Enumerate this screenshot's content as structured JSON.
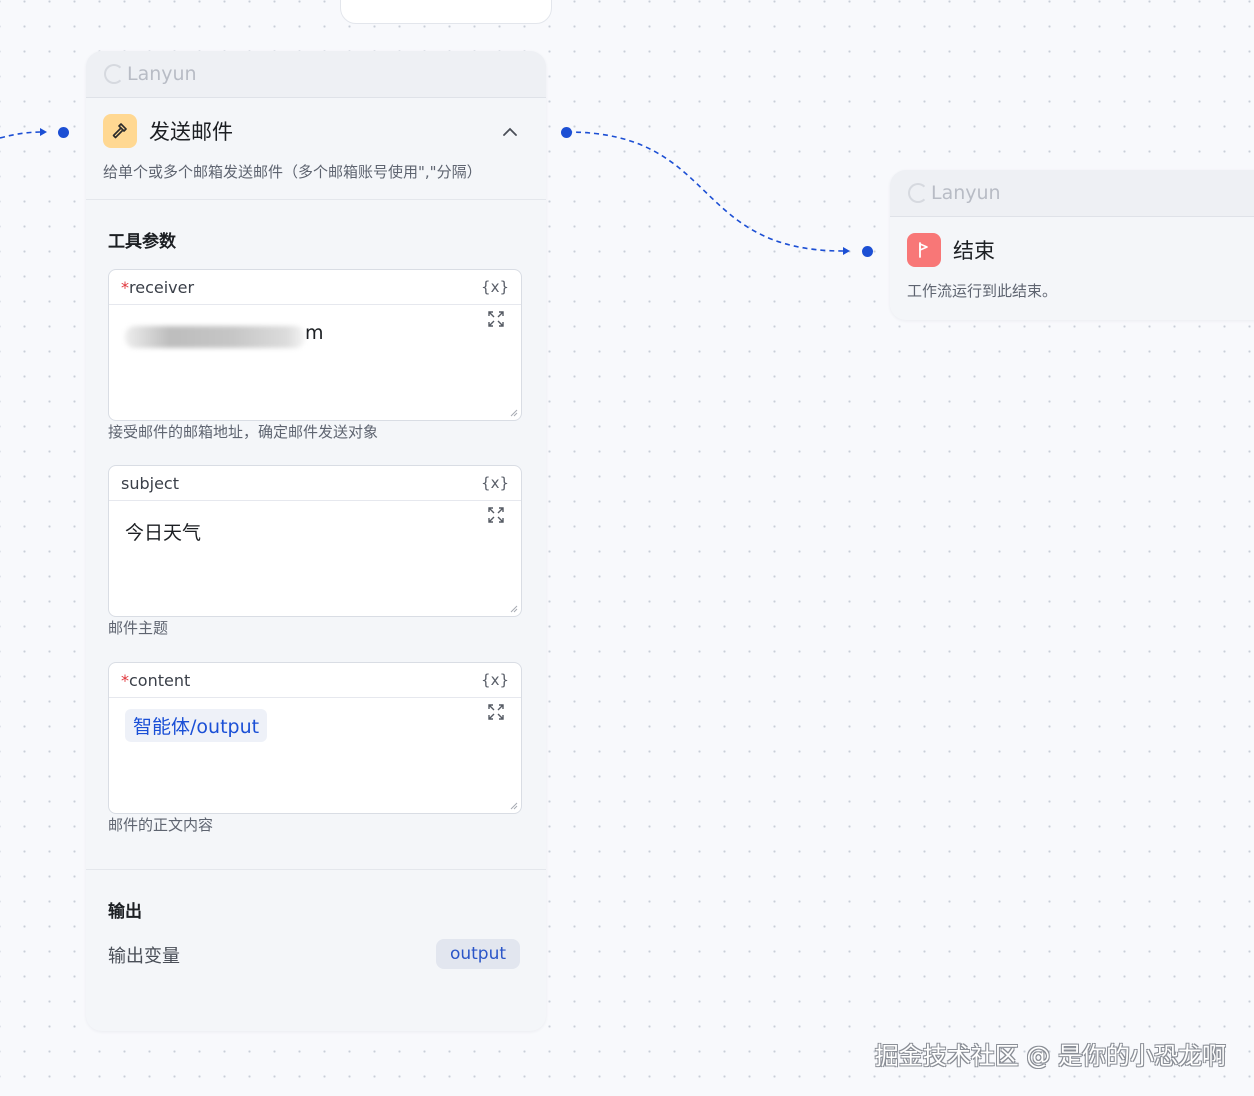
{
  "colors": {
    "accent": "#1c4fd4",
    "tool_icon_bg": "#ffd892",
    "end_icon_bg": "#f87777",
    "required_mark": "#e0343a"
  },
  "send_email_node": {
    "header_label": "Lanyun",
    "title": "发送邮件",
    "icon": "hammer-icon",
    "description": "给单个或多个邮箱发送邮件（多个邮箱账号使用\",\"分隔）",
    "params_title": "工具参数",
    "params": [
      {
        "label": "receiver",
        "required": true,
        "required_mark": "*",
        "var_symbol": "{x}",
        "value": "m",
        "blurred": true,
        "help": "接受邮件的邮箱地址，确定邮件发送对象"
      },
      {
        "label": "subject",
        "required": false,
        "var_symbol": "{x}",
        "value": "今日天气",
        "help": "邮件主题"
      },
      {
        "label": "content",
        "required": true,
        "required_mark": "*",
        "var_symbol": "{x}",
        "value": "智能体/output",
        "value_is_tag": true,
        "help": "邮件的正文内容"
      }
    ],
    "output_title": "输出",
    "output_label": "输出变量",
    "output_value": "output"
  },
  "end_node": {
    "header_label": "Lanyun",
    "title": "结束",
    "icon": "flag-icon",
    "description": "工作流运行到此结束。"
  },
  "watermark": "掘金技术社区 @ 是你的小恐龙啊"
}
